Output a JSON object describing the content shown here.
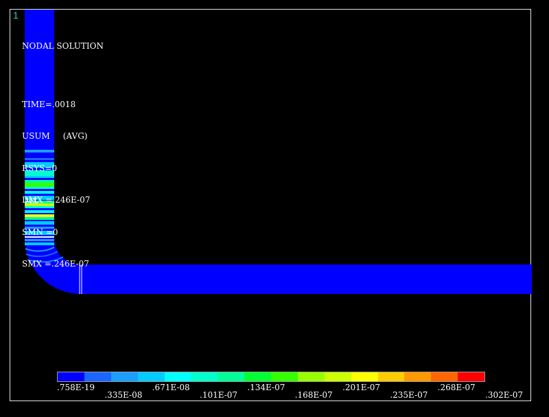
{
  "window_number": "1",
  "info": {
    "title": "NODAL SOLUTION",
    "time": "TIME=.0018",
    "usum": "USUM     (AVG)",
    "rsys": "RSYS=0",
    "dmx": "DMX =.246E-07",
    "smn": "SMN =0",
    "smx": "SMX =.246E-07"
  },
  "mx_label": "MX",
  "legend": {
    "colors": [
      "#0000ff",
      "#1a66ff",
      "#1a9fff",
      "#00ccff",
      "#00ffff",
      "#00ffcc",
      "#00ff99",
      "#00ff33",
      "#33ff00",
      "#99ff00",
      "#ccff00",
      "#ffff00",
      "#ffcc00",
      "#ff9900",
      "#ff6600",
      "#ff0000"
    ],
    "labels": [
      ".758E-19",
      ".335E-08",
      ".671E-08",
      ".101E-07",
      ".134E-07",
      ".168E-07",
      ".201E-07",
      ".235E-07",
      ".268E-07",
      ".302E-07"
    ]
  },
  "colors": {
    "background": "#000000",
    "base_blue": "#0000ff",
    "frame": "#e6e6e6"
  }
}
